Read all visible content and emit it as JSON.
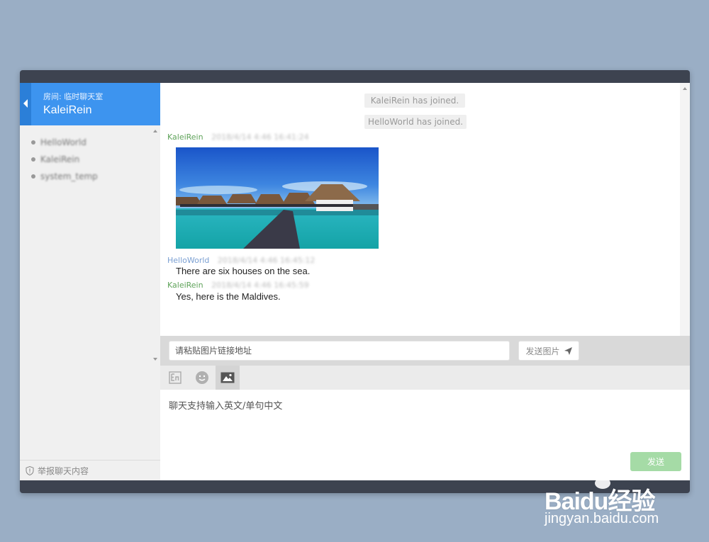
{
  "sidebar": {
    "room_label": "房间: 临时聊天室",
    "current_user": "KaleiRein",
    "users": [
      "HelloWorld",
      "KaleiRein",
      "system_temp"
    ],
    "report_label": "举报聊天内容"
  },
  "chat": {
    "system_messages": [
      "KaleiRein has joined.",
      "HelloWorld has joined."
    ],
    "messages": [
      {
        "sender": "KaleiRein",
        "time": "2018/4/14 4:46 16:41:24",
        "text": "",
        "image": "overwater bungalows"
      },
      {
        "sender": "HelloWorld",
        "time": "2018/4/14 4:46 16:45:12",
        "text": "There are six houses on the sea."
      },
      {
        "sender": "KaleiRein",
        "time": "2018/4/14 4:46 16:45:59",
        "text": "Yes, here is the Maldives."
      }
    ]
  },
  "image_bar": {
    "url_placeholder": "请粘贴图片链接地址",
    "send_image_label": "发送图片"
  },
  "toolbar": {
    "icons": [
      "english-input-icon",
      "emoji-icon",
      "image-icon"
    ]
  },
  "compose": {
    "placeholder": "聊天支持输入英文/单句中文",
    "send_label": "发送"
  },
  "watermark": {
    "logo": "Baidu经验",
    "url": "jingyan.baidu.com"
  },
  "colors": {
    "accent": "#3d94ef",
    "send_button": "#a5dba6",
    "frame": "#3d4350",
    "background": "#9aaec5"
  }
}
